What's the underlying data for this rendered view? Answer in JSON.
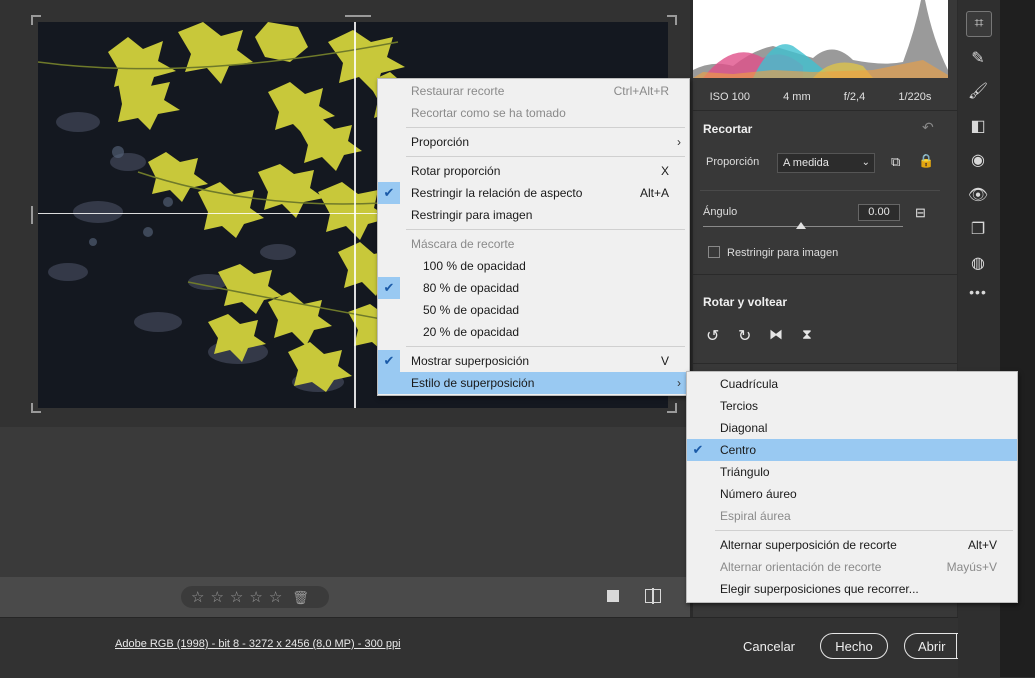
{
  "exif": [
    "ISO 100",
    "4 mm",
    "f/2,4",
    "1/220s"
  ],
  "crop_section": {
    "title": "Recortar",
    "proportion_label": "Proporción",
    "proportion_value": "A medida",
    "angle_label": "Ángulo",
    "angle_value": "0.00",
    "constrain_label": "Restringir para imagen"
  },
  "rotate_section": {
    "title": "Rotar y voltear"
  },
  "footer": {
    "file_info": "Adobe RGB (1998) - bit 8 - 3272 x 2456 (8,0 MP) - 300 ppi",
    "cancel": "Cancelar",
    "done": "Hecho",
    "open": "Abrir"
  },
  "rating_stars": 0,
  "context_menu": {
    "items": [
      {
        "label": "Restaurar recorte",
        "shortcut": "Ctrl+Alt+R",
        "disabled": true
      },
      {
        "label": "Recortar como se ha tomado",
        "shortcut": "",
        "disabled": true
      },
      {
        "label": "Proporción",
        "submenu": true
      },
      {
        "label": "Rotar proporción",
        "shortcut": "X"
      },
      {
        "label": "Restringir la relación de aspecto",
        "shortcut": "Alt+A",
        "checked": true
      },
      {
        "label": "Restringir para imagen",
        "shortcut": ""
      },
      {
        "label": "Máscara de recorte",
        "disabled": true
      },
      {
        "label": "100 % de opacidad"
      },
      {
        "label": "80 % de opacidad",
        "checked": true
      },
      {
        "label": "50 % de opacidad"
      },
      {
        "label": "20 % de opacidad"
      },
      {
        "label": "Mostrar superposición",
        "shortcut": "V",
        "checked": true
      },
      {
        "label": "Estilo de superposición",
        "submenu": true,
        "highlighted": true
      }
    ]
  },
  "submenu": {
    "items": [
      {
        "label": "Cuadrícula"
      },
      {
        "label": "Tercios"
      },
      {
        "label": "Diagonal"
      },
      {
        "label": "Centro",
        "checked": true,
        "highlighted": true
      },
      {
        "label": "Triángulo"
      },
      {
        "label": "Número áureo"
      },
      {
        "label": "Espiral áurea",
        "disabled": true
      },
      {
        "label": "Alternar superposición de recorte",
        "shortcut": "Alt+V"
      },
      {
        "label": "Alternar orientación de recorte",
        "shortcut": "Mayús+V",
        "disabled": true
      },
      {
        "label": "Elegir superposiciones que recorrer..."
      }
    ]
  },
  "colors": {
    "accent": "#99c9f2",
    "check": "#1a5aa8",
    "leaf": "#c8c83a"
  }
}
